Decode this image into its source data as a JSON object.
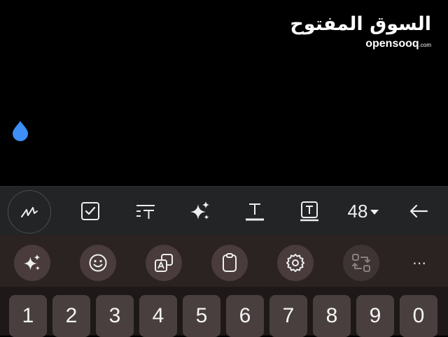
{
  "watermark": {
    "arabic": "السوق المفتوح",
    "latin": "opensooq",
    "latin_suffix": ".com"
  },
  "toolbar": {
    "icons": [
      "handwriting-pen-icon",
      "checkbox-icon",
      "text-spacing-icon",
      "sparkle-ai-icon",
      "underline-text-icon",
      "text-box-icon",
      "undo-arrow-icon"
    ],
    "font_size": "48"
  },
  "suggestions": {
    "icons": [
      "sparkle-ai-icon",
      "emoji-icon",
      "translate-icon",
      "clipboard-icon",
      "settings-icon",
      "swap-icon"
    ],
    "more": "⋯"
  },
  "number_row": [
    "1",
    "2",
    "3",
    "4",
    "5",
    "6",
    "7",
    "8",
    "9",
    "0"
  ],
  "colors": {
    "accent_blue": "#3d8ef5",
    "toolbar_bg": "#222426",
    "keyboard_bg": "#1f1818",
    "key_bg": "#4a3f3f"
  }
}
